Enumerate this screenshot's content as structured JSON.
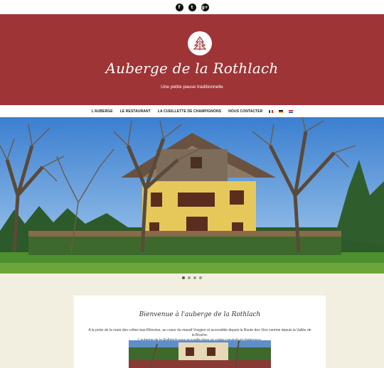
{
  "social": [
    {
      "name": "facebook",
      "glyph": "f"
    },
    {
      "name": "twitter",
      "glyph": "t"
    },
    {
      "name": "google-plus",
      "glyph": "g+"
    }
  ],
  "header": {
    "title": "Auberge de la Rothlach",
    "tagline": "Une petite pause traditionnelle",
    "bg_color": "#9e3436"
  },
  "nav": {
    "items": [
      "L'AUBERGE",
      "LE RESTAURANT",
      "LA CUEILLETTE DE CHAMPIGNONS",
      "NOUS CONTACTER"
    ],
    "flags": [
      "fr",
      "de",
      "nl"
    ]
  },
  "slider": {
    "count": 4,
    "active": 0
  },
  "welcome": {
    "title": "Bienvenue à l'auberge de la Rothlach",
    "line1": "A la porte de la route des crêtes bas-Rhinoise, au coeur du massif Vosgien et accessible depuis la Route des Vins comme depuis la Vallée de la Bruche.",
    "line2": "L'auberge de la Rothlach vous accueille dans un cadre convivial et chaleureux."
  }
}
